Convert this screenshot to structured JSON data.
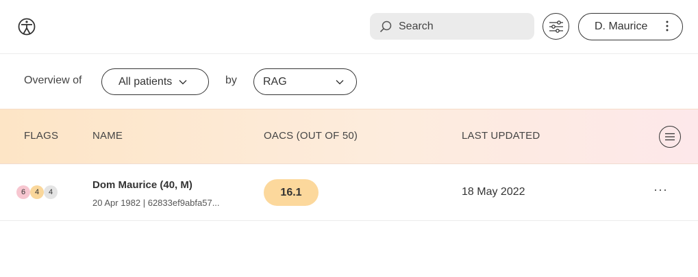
{
  "header": {
    "logo_icon": "accessibility-person-icon",
    "search": {
      "placeholder": "Search",
      "value": ""
    },
    "filter_icon": "sliders-icon",
    "user": {
      "name": "D. Maurice",
      "menu_icon": "vertical-dots-icon"
    }
  },
  "overview": {
    "label": "Overview of",
    "patients_select": "All patients",
    "by_label": "by",
    "group_select": "RAG"
  },
  "table": {
    "columns": [
      "FLAGS",
      "NAME",
      "OACS (OUT OF 50)",
      "LAST UPDATED"
    ],
    "header_menu_icon": "hamburger-circle-icon",
    "rows": [
      {
        "flags": {
          "red": "6",
          "amber": "4",
          "grey": "4"
        },
        "name": "Dom Maurice (40, M)",
        "meta": "20 Apr 1982 | 62833ef9abfa57...",
        "score": "16.1",
        "last_updated": "18 May 2022",
        "more_label": "···"
      }
    ]
  },
  "colors": {
    "flag_red": "#f7c6d0",
    "flag_amber": "#fad79b",
    "flag_grey": "#e4e4e4",
    "score_amber": "#fcd89c",
    "header_gradient_start": "#fde5c6",
    "header_gradient_end": "#fde8ea"
  }
}
